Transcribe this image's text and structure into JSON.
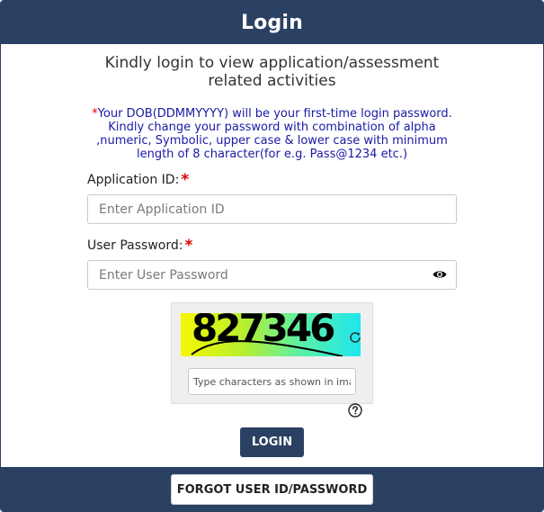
{
  "header": {
    "title": "Login"
  },
  "intro": {
    "text": "Kindly login to view application/assessment related activities"
  },
  "notice": {
    "star": "*",
    "text": "Your DOB(DDMMYYYY) will be your first-time login password. Kindly change your password with combination of alpha ,numeric, Symbolic, upper case & lower case with minimum length of 8 character(for e.g. Pass@1234 etc.)"
  },
  "form": {
    "application_id": {
      "label": "Application ID:",
      "required": "*",
      "placeholder": "Enter Application ID",
      "value": ""
    },
    "password": {
      "label": "User Password:",
      "required": "*",
      "placeholder": "Enter User Password",
      "value": ""
    }
  },
  "captcha": {
    "code": "827346",
    "input_placeholder": "Type characters as shown in image",
    "icons": {
      "refresh": "refresh-icon",
      "help": "help-icon"
    }
  },
  "buttons": {
    "login": "LOGIN",
    "forgot": "FORGOT USER ID/PASSWORD"
  },
  "colors": {
    "primary": "#2b4163",
    "required": "#e00000",
    "notice": "#1a1aa6"
  },
  "icons": {
    "show_password": "eye-icon"
  }
}
